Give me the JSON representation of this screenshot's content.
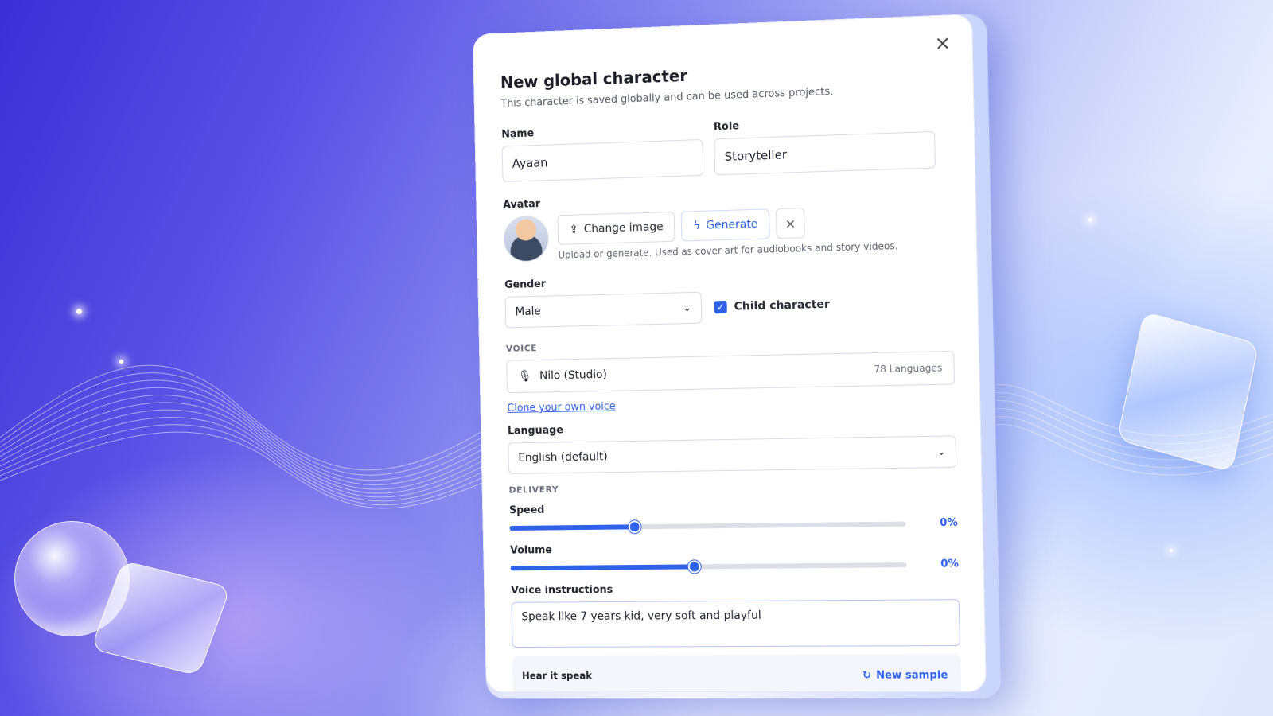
{
  "dialog": {
    "title": "New global character",
    "subtitle": "This character is saved globally and can be used across projects.",
    "close_icon": "×"
  },
  "fields": {
    "name_label": "Name",
    "name_value": "Ayaan",
    "role_label": "Role",
    "role_value": "Storyteller"
  },
  "avatar": {
    "label": "Avatar",
    "change_label": "Change image",
    "generate_label": "Generate",
    "remove_icon": "×",
    "hint": "Upload or generate. Used as cover art for audiobooks and story videos."
  },
  "gender": {
    "label": "Gender",
    "value": "Male",
    "child_label": "Child character",
    "child_checked": true
  },
  "voice": {
    "section": "VOICE",
    "value": "Nilo (Studio)",
    "languages": "78 Languages",
    "clone_link": "Clone your own voice"
  },
  "language": {
    "label": "Language",
    "value": "English (default)"
  },
  "delivery": {
    "section": "DELIVERY",
    "speed_label": "Speed",
    "speed_value": "0%",
    "speed_position": 0.32,
    "volume_label": "Volume",
    "volume_value": "0%",
    "volume_position": 0.47
  },
  "instructions": {
    "label": "Voice instructions",
    "value": "Speak like 7 years kid, very soft and playful"
  },
  "hear": {
    "title": "Hear it speak",
    "new_sample": "New sample"
  },
  "colors": {
    "accent": "#2f62e8",
    "background_start": "#3a2fd6",
    "background_end": "#e8eefd"
  }
}
